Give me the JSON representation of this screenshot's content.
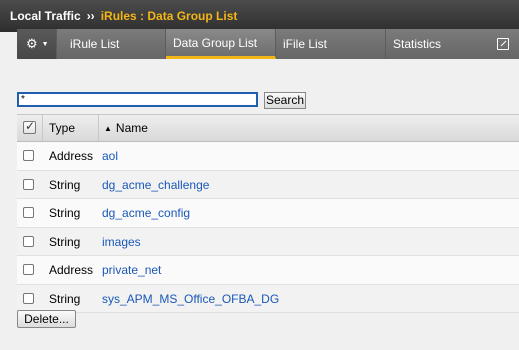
{
  "breadcrumb": {
    "root": "Local Traffic",
    "separator": "››",
    "current": "iRules : Data Group List"
  },
  "tabs": [
    {
      "label": "",
      "icon": "gear-icon"
    },
    {
      "label": "iRule List"
    },
    {
      "label": "Data Group List",
      "active": true
    },
    {
      "label": "iFile List"
    },
    {
      "label": "Statistics",
      "icon": "external-link-icon"
    }
  ],
  "search": {
    "value": "*",
    "button_label": "Search"
  },
  "table": {
    "columns": [
      "Type",
      "Name"
    ],
    "sort_column": "Name",
    "rows": [
      {
        "type": "Address",
        "name": "aol"
      },
      {
        "type": "String",
        "name": "dg_acme_challenge"
      },
      {
        "type": "String",
        "name": "dg_acme_config"
      },
      {
        "type": "String",
        "name": "images"
      },
      {
        "type": "Address",
        "name": "private_net"
      },
      {
        "type": "String",
        "name": "sys_APM_MS_Office_OFBA_DG"
      }
    ]
  },
  "actions": {
    "delete_label": "Delete..."
  },
  "colors": {
    "accent": "#f3b617",
    "link": "#1a58b8",
    "header_bg": "#3a3a3a"
  }
}
